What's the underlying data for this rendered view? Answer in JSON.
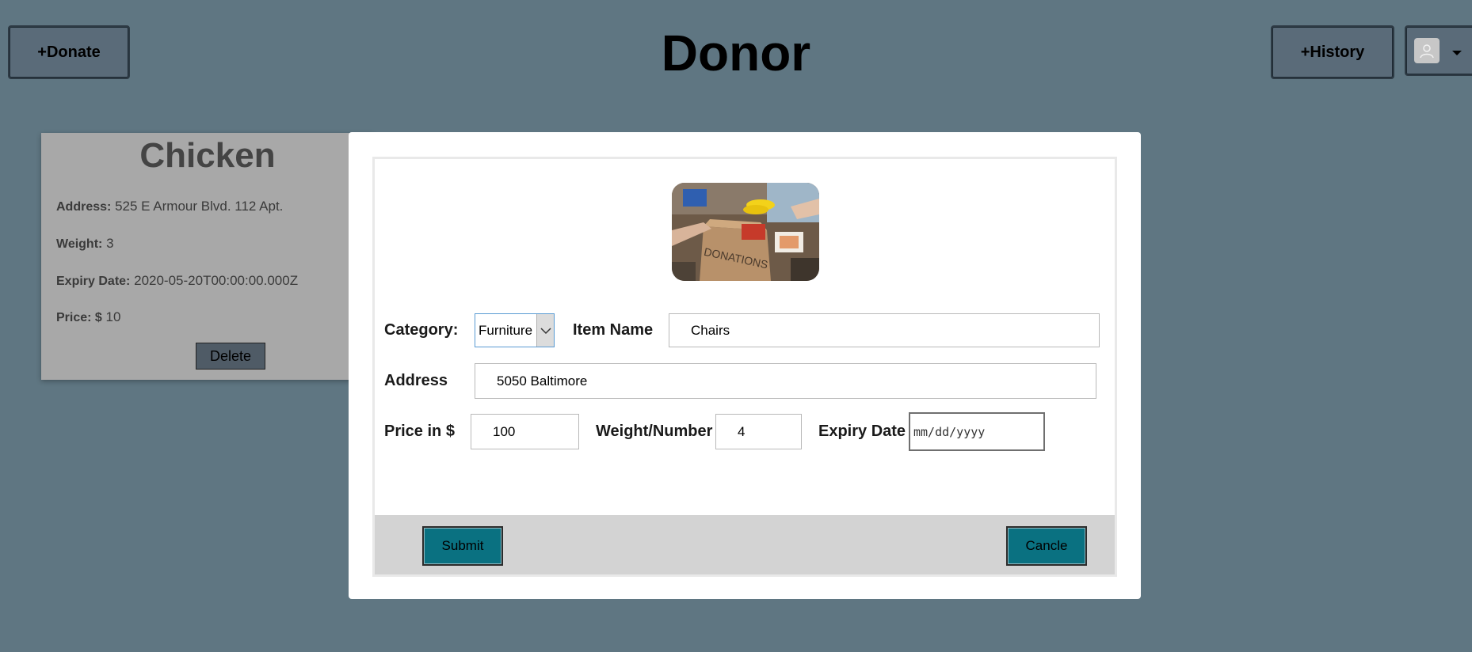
{
  "header": {
    "title": "Donor",
    "donate_label": "+Donate",
    "history_label": "+History",
    "user_icon": "user-icon"
  },
  "card": {
    "title": "Chicken",
    "address_label": "Address:",
    "address_value": "525 E Armour Blvd. 112 Apt.",
    "weight_label": "Weight:",
    "weight_value": "3",
    "expiry_label": "Expiry Date:",
    "expiry_value": "2020-05-20T00:00:00.000Z",
    "price_label": "Price: $",
    "price_value": "10",
    "delete_label": "Delete"
  },
  "modal": {
    "category_label": "Category:",
    "category_value": "Furniture",
    "item_name_label": "Item Name",
    "item_name_value": "Chairs",
    "address_label": "Address",
    "address_value": "5050 Baltimore",
    "price_label": "Price in $",
    "price_value": "100",
    "weight_label": "Weight/Number",
    "weight_value": "4",
    "expiry_label": "Expiry Date",
    "expiry_placeholder": "mm/dd/yyyy",
    "box_text": "DONATIONS",
    "submit_label": "Submit",
    "cancel_label": "Cancle"
  },
  "colors": {
    "background": "#5f7682",
    "accent": "#0a7181",
    "footer": "#d3d3d3"
  }
}
